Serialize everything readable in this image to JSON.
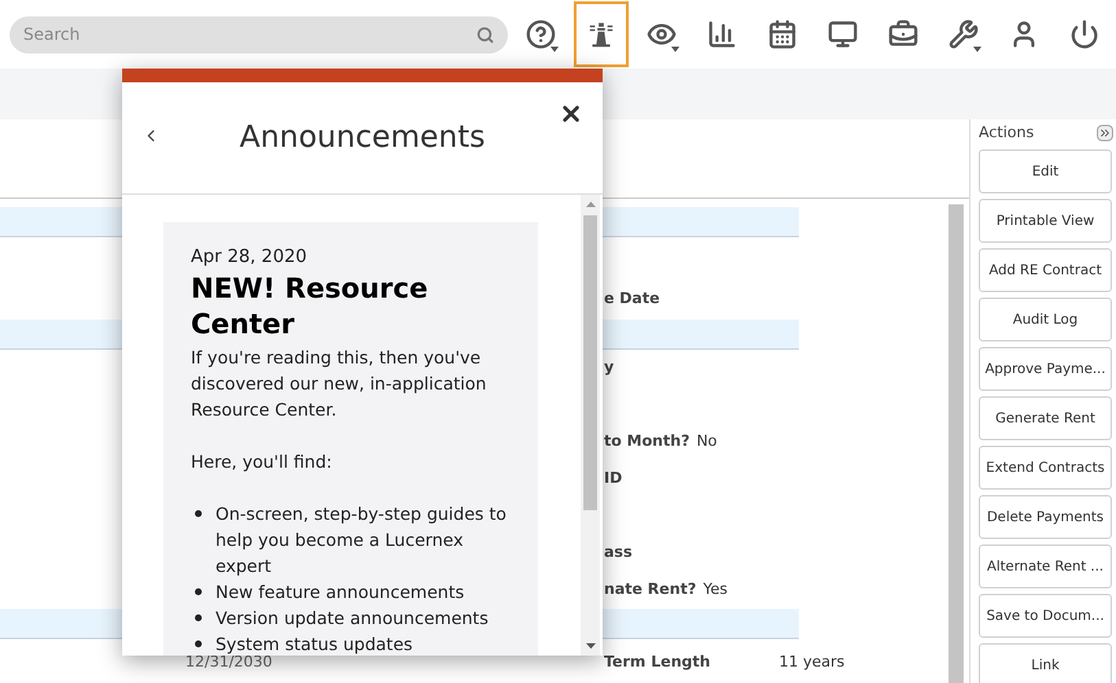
{
  "search": {
    "placeholder": "Search"
  },
  "toolbar": [
    {
      "kind": "help",
      "selected": false,
      "menu": true
    },
    {
      "kind": "lighthouse",
      "selected": true,
      "menu": false
    },
    {
      "kind": "view",
      "selected": false,
      "menu": true
    },
    {
      "kind": "reports",
      "selected": false,
      "menu": false
    },
    {
      "kind": "calendar",
      "selected": false,
      "menu": false
    },
    {
      "kind": "monitor",
      "selected": false,
      "menu": false
    },
    {
      "kind": "briefcase",
      "selected": false,
      "menu": false
    },
    {
      "kind": "tools",
      "selected": false,
      "menu": true
    },
    {
      "kind": "profile",
      "selected": false,
      "menu": false
    },
    {
      "kind": "power",
      "selected": false,
      "menu": false
    }
  ],
  "details": {
    "rows": [
      {
        "kind": "band"
      },
      {
        "kind": "blank"
      },
      {
        "kind": "field",
        "label": "e Date"
      },
      {
        "kind": "band"
      },
      {
        "kind": "field",
        "label": "y"
      },
      {
        "kind": "blank"
      },
      {
        "kind": "field",
        "label": "to Month?",
        "value": "No"
      },
      {
        "kind": "field",
        "label": "ID"
      },
      {
        "kind": "blank"
      },
      {
        "kind": "field",
        "label": "ass"
      },
      {
        "kind": "field",
        "label": "nate Rent?",
        "value": "Yes"
      },
      {
        "kind": "band"
      },
      {
        "kind": "field",
        "left_value": "12/31/2030",
        "label": "Term Length",
        "value": "11 years"
      }
    ]
  },
  "actions": {
    "title": "Actions",
    "buttons": [
      "Edit",
      "Printable View",
      "Add RE Contract",
      "Audit Log",
      "Approve Payme...",
      "Generate Rent",
      "Extend Contracts",
      "Delete Payments",
      "Alternate Rent ...",
      "Save to Docum...",
      "Link"
    ]
  },
  "modal": {
    "title": "Announcements",
    "date": "Apr 28, 2020",
    "heading": "NEW! Resource Center",
    "paragraphs": [
      "If you're reading this, then you've discovered our new, in-application Resource Center.",
      "Here, you'll find:"
    ],
    "bullets": [
      "On-screen, step-by-step guides to help you become a Lucernex expert",
      "New feature announcements",
      "Version update announcements",
      "System status updates"
    ]
  }
}
